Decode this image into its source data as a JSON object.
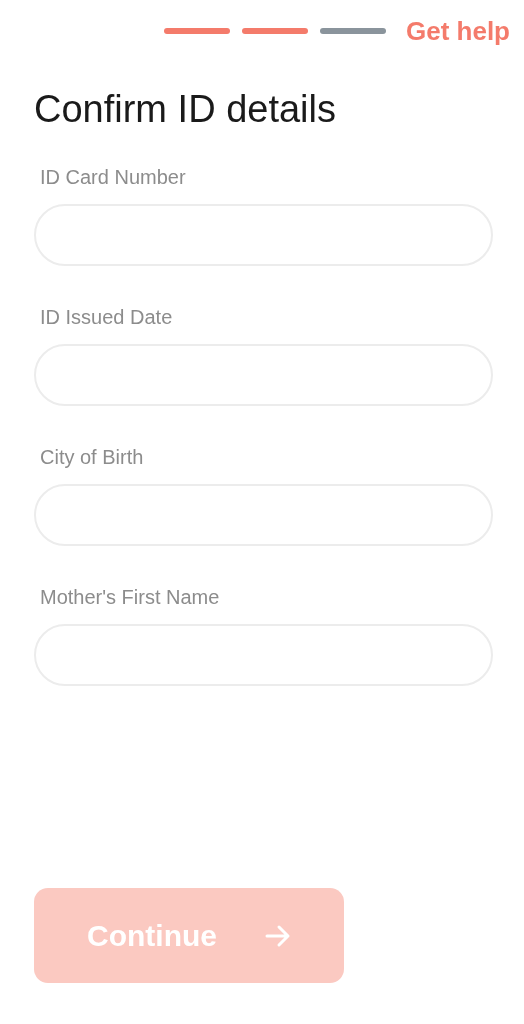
{
  "progress_steps": [
    {
      "done": true
    },
    {
      "done": true
    },
    {
      "done": false
    }
  ],
  "help_link": "Get help",
  "title": "Confirm ID details",
  "fields": [
    {
      "label": "ID Card Number"
    },
    {
      "label": "ID Issued Date"
    },
    {
      "label": "City of Birth"
    },
    {
      "label": "Mother's First Name"
    }
  ],
  "continue_button": {
    "label": "Continue",
    "disabled": true
  }
}
